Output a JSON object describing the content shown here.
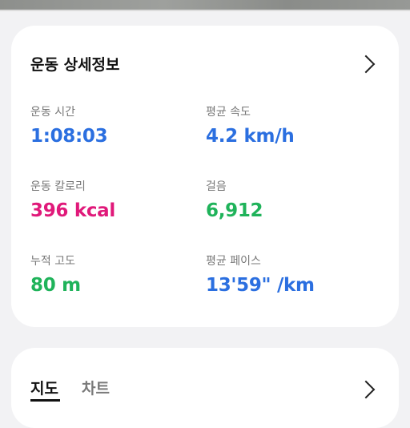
{
  "details": {
    "title": "운동 상세정보",
    "stats": [
      {
        "label": "운동 시간",
        "value": "1:08:03",
        "color": "#2b6fe0"
      },
      {
        "label": "평균 속도",
        "value": "4.2 km/h",
        "color": "#2b6fe0"
      },
      {
        "label": "운동 칼로리",
        "value": "396 kcal",
        "color": "#e0197a"
      },
      {
        "label": "걸음",
        "value": "6,912",
        "color": "#1fb35a"
      },
      {
        "label": "누적 고도",
        "value": "80 m",
        "color": "#1fb35a"
      },
      {
        "label": "평균 페이스",
        "value": "13'59\" /km",
        "color": "#2b6fe0"
      }
    ]
  },
  "map_card": {
    "tabs": [
      {
        "label": "지도",
        "selected": true
      },
      {
        "label": "차트",
        "selected": false
      }
    ]
  }
}
